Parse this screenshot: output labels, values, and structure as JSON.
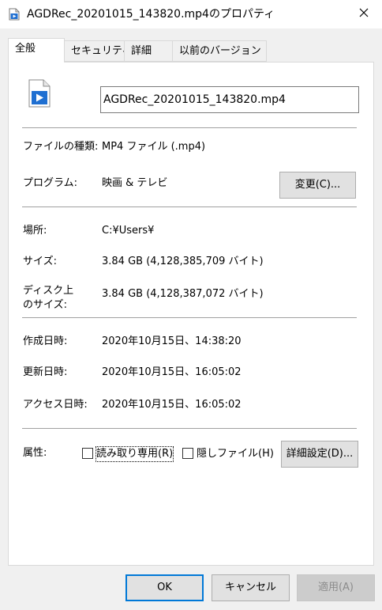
{
  "window": {
    "title": "AGDRec_20201015_143820.mp4のプロパティ",
    "icon": "video-file-icon",
    "close_glyph": "✕"
  },
  "tabs": [
    {
      "label": "全般",
      "active": true
    },
    {
      "label": "セキュリティ",
      "active": false
    },
    {
      "label": "詳細",
      "active": false
    },
    {
      "label": "以前のバージョン",
      "active": false
    }
  ],
  "file": {
    "name": "AGDRec_20201015_143820.mp4",
    "icon": "video-file-icon"
  },
  "general": {
    "file_type_label": "ファイルの種類:",
    "file_type_value": "MP4 ファイル (.mp4)",
    "program_label": "プログラム:",
    "program_value": "映画 & テレビ",
    "change_button_label": "変更(C)...",
    "location_label": "場所:",
    "location_value": "C:¥Users¥",
    "size_label": "サイズ:",
    "size_value": "3.84 GB (4,128,385,709 バイト)",
    "disk_size_label_line1": "ディスク上",
    "disk_size_label_line2": "のサイズ:",
    "disk_size_value": "3.84 GB (4,128,387,072 バイト)",
    "created_label": "作成日時:",
    "created_value": "2020年10月15日、14:38:20",
    "modified_label": "更新日時:",
    "modified_value": "2020年10月15日、16:05:02",
    "accessed_label": "アクセス日時:",
    "accessed_value": "2020年10月15日、16:05:02",
    "attributes_label": "属性:",
    "readonly_label": "読み取り専用(R)",
    "readonly_checked": false,
    "hidden_label": "隠しファイル(H)",
    "hidden_checked": false,
    "advanced_button_label": "詳細設定(D)..."
  },
  "footer": {
    "ok_label": "OK",
    "cancel_label": "キャンセル",
    "apply_label": "適用(A)"
  },
  "colors": {
    "accent": "#0078d7",
    "panel_bg": "#ffffff",
    "window_bg": "#f0f0f0"
  }
}
